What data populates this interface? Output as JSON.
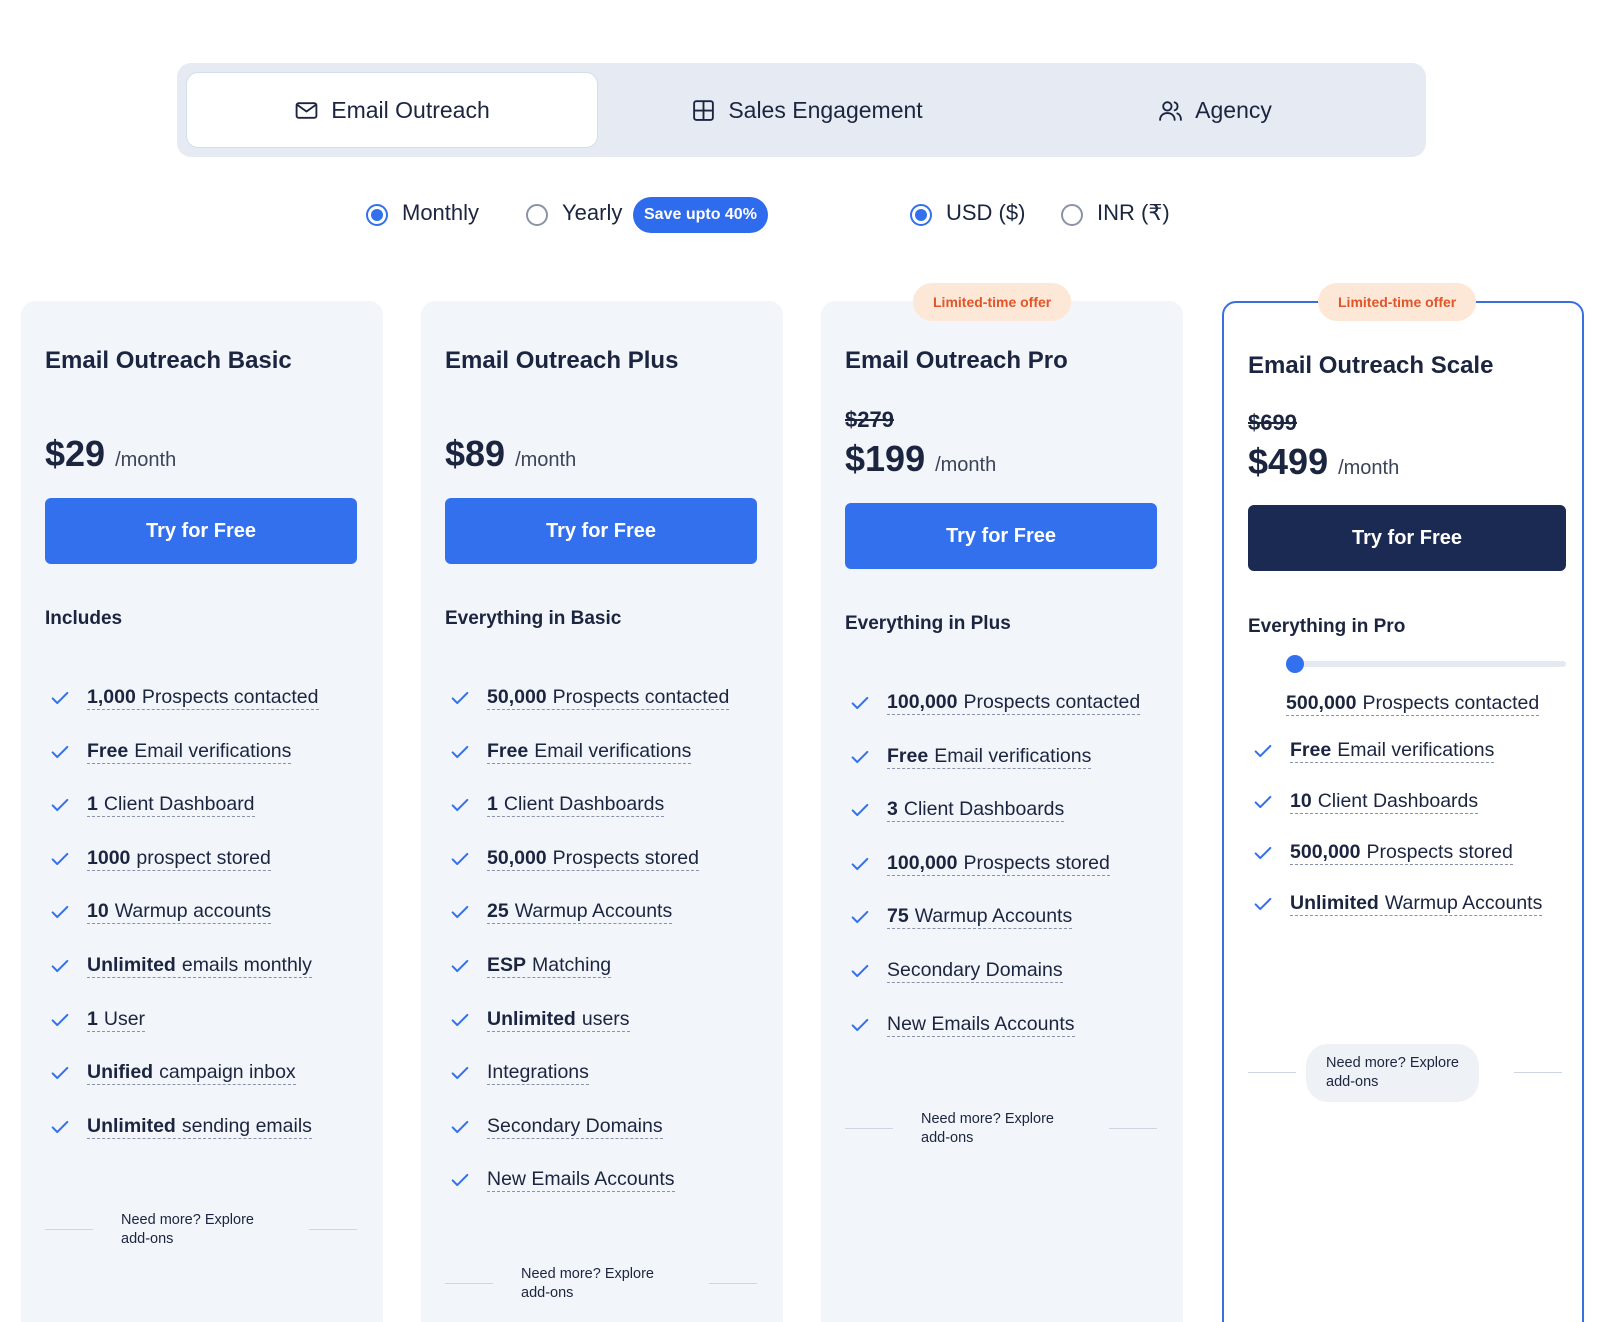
{
  "tabs": [
    {
      "label": "Email Outreach",
      "icon": "mail-icon",
      "active": true
    },
    {
      "label": "Sales Engagement",
      "icon": "grid-icon",
      "active": false
    },
    {
      "label": "Agency",
      "icon": "users-icon",
      "active": false
    }
  ],
  "billing": {
    "monthly_label": "Monthly",
    "yearly_label": "Yearly",
    "selected": "Monthly",
    "save_badge": "Save upto 40%"
  },
  "currency": {
    "usd_label": "USD ($)",
    "inr_label": "INR (₹)",
    "selected": "USD ($)"
  },
  "colors": {
    "accent": "#3370ee",
    "dark_cta": "#1b2a52",
    "offer_bg": "#fde7d6",
    "offer_text": "#e0552a",
    "card_bg": "#f2f5fa"
  },
  "plans": [
    {
      "title": "Email Outreach Basic",
      "price": "$29",
      "period": "/month",
      "cta": "Try for Free",
      "includes": "Includes",
      "features": [
        {
          "strong": "1,000",
          "text": "Prospects contacted"
        },
        {
          "strong": "Free",
          "text": "Email verifications"
        },
        {
          "strong": "1",
          "text": "Client Dashboard"
        },
        {
          "strong": "1000",
          "text": "prospect stored"
        },
        {
          "strong": "10",
          "text": "Warmup accounts"
        },
        {
          "strong": "Unlimited",
          "text": "emails monthly"
        },
        {
          "strong": "1",
          "text": "User"
        },
        {
          "strong": "Unified",
          "text": "campaign inbox"
        },
        {
          "strong": "Unlimited",
          "text": "sending emails"
        }
      ],
      "addons_line1": "Need more? Explore",
      "addons_line2": "add-ons"
    },
    {
      "title": "Email Outreach Plus",
      "price": "$89",
      "period": "/month",
      "cta": "Try for Free",
      "includes": "Everything in Basic",
      "features": [
        {
          "strong": "50,000",
          "text": "Prospects contacted"
        },
        {
          "strong": "Free",
          "text": "Email verifications"
        },
        {
          "strong": "1",
          "text": "Client Dashboards"
        },
        {
          "strong": "50,000",
          "text": "Prospects stored"
        },
        {
          "strong": "25",
          "text": "Warmup Accounts"
        },
        {
          "strong": "ESP",
          "text": "Matching"
        },
        {
          "strong": "Unlimited",
          "text": "users"
        },
        {
          "strong": "",
          "text": "Integrations"
        },
        {
          "strong": "",
          "text": "Secondary Domains"
        },
        {
          "strong": "",
          "text": "New Emails Accounts"
        }
      ],
      "addons_line1": "Need more? Explore",
      "addons_line2": "add-ons"
    },
    {
      "title": "Email Outreach Pro",
      "offer": "Limited-time offer",
      "old_price": "$279",
      "price": "$199",
      "period": "/month",
      "cta": "Try for Free",
      "includes": "Everything in Plus",
      "features": [
        {
          "strong": "100,000",
          "text": "Prospects contacted"
        },
        {
          "strong": "Free",
          "text": "Email verifications"
        },
        {
          "strong": "3",
          "text": "Client Dashboards"
        },
        {
          "strong": "100,000",
          "text": "Prospects stored"
        },
        {
          "strong": "75",
          "text": "Warmup Accounts"
        },
        {
          "strong": "",
          "text": "Secondary Domains"
        },
        {
          "strong": "",
          "text": "New Emails Accounts"
        }
      ],
      "addons_line1": "Need more? Explore",
      "addons_line2": "add-ons"
    },
    {
      "title": "Email Outreach Scale",
      "offer": "Limited-time offer",
      "old_price": "$699",
      "price": "$499",
      "period": "/month",
      "cta": "Try for Free",
      "includes": "Everything in Pro",
      "slider_level": 0,
      "slider_value": {
        "strong": "500,000",
        "text": "Prospects contacted"
      },
      "features": [
        {
          "strong": "Free",
          "text": "Email verifications"
        },
        {
          "strong": "10",
          "text": "Client Dashboards"
        },
        {
          "strong": "500,000",
          "text": "Prospects stored"
        },
        {
          "strong": "Unlimited",
          "text": "Warmup Accounts"
        }
      ],
      "addons_line1": "Need more? Explore",
      "addons_line2": "add-ons"
    }
  ]
}
